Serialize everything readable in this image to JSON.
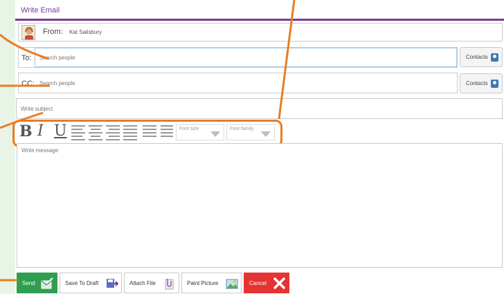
{
  "window": {
    "title": "Write Email"
  },
  "from": {
    "label": "From:",
    "name": "Kat Salisbury"
  },
  "to": {
    "label": "To:",
    "placeholder": "Search people",
    "contacts_label": "Contacts"
  },
  "cc": {
    "label": "CC:",
    "placeholder": "Search people",
    "contacts_label": "Contacts"
  },
  "subject": {
    "placeholder": "Write subject"
  },
  "toolbar": {
    "bold": "B",
    "italic": "I",
    "underline": "U",
    "font_size_placeholder": "Font size",
    "font_family_placeholder": "Font family"
  },
  "message": {
    "placeholder": "Write message"
  },
  "actions": {
    "send": "Send",
    "save_draft": "Save To Draft",
    "attach_file": "Attach File",
    "paint_picture": "Paint Picture",
    "cancel": "Cancel"
  },
  "colors": {
    "accent": "#7a3a96",
    "send": "#2f9e4f",
    "cancel": "#e53333",
    "callout": "#e97c22",
    "page_bg": "#e8f4e6"
  },
  "icons": {
    "contacts": "contact-book-icon",
    "send": "send-mail-icon",
    "save_draft": "floppy-arrow-icon",
    "attach_file": "paperclip-icon",
    "paint_picture": "picture-icon",
    "cancel": "close-icon"
  }
}
